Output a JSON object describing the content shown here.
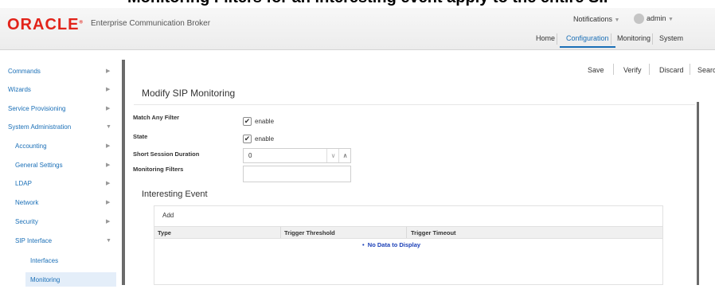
{
  "page_caption": "Monitoring Filters for an interesting event apply to the entire SIP",
  "header": {
    "logo": "ORACLE",
    "app_name": "Enterprise Communication Broker",
    "notifications": "Notifications",
    "user": "admin",
    "nav": [
      "Home",
      "Configuration",
      "Monitoring",
      "System"
    ],
    "active_nav": "Configuration"
  },
  "sidebar": {
    "items": [
      {
        "label": "Commands",
        "expanded": false
      },
      {
        "label": "Wizards",
        "expanded": false
      },
      {
        "label": "Service Provisioning",
        "expanded": false
      },
      {
        "label": "System Administration",
        "expanded": true
      },
      {
        "label": "Accounting",
        "expanded": false
      },
      {
        "label": "General Settings",
        "expanded": false
      },
      {
        "label": "LDAP",
        "expanded": false
      },
      {
        "label": "Network",
        "expanded": false
      },
      {
        "label": "Security",
        "expanded": false
      },
      {
        "label": "SIP Interface",
        "expanded": true
      },
      {
        "label": "Interfaces"
      },
      {
        "label": "Monitoring",
        "selected": true
      }
    ]
  },
  "toolbar": {
    "save": "Save",
    "verify": "Verify",
    "discard": "Discard",
    "search": "Search"
  },
  "form": {
    "title": "Modify SIP Monitoring",
    "match_any_filter": {
      "label": "Match Any Filter",
      "checked": true,
      "text": "enable"
    },
    "state": {
      "label": "State",
      "checked": true,
      "text": "enable"
    },
    "short_session_duration": {
      "label": "Short Session Duration",
      "value": "0"
    },
    "monitoring_filters": {
      "label": "Monitoring Filters",
      "value": ""
    }
  },
  "interesting_event": {
    "title": "Interesting Event",
    "add": "Add",
    "columns": [
      "Type",
      "Trigger Threshold",
      "Trigger Timeout"
    ],
    "empty_text": "No Data to Display"
  },
  "icons": {
    "expand": "chevron-right-icon",
    "collapse": "chevron-down-icon",
    "checkmark": "checkmark-icon",
    "avatar": "user-avatar-icon"
  }
}
